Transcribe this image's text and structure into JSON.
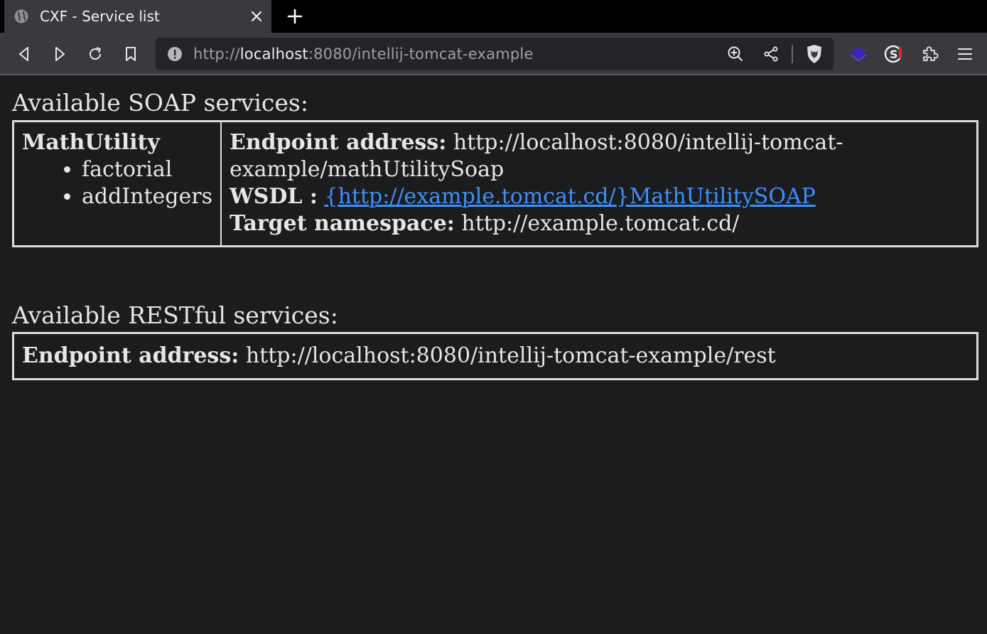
{
  "browser": {
    "tab": {
      "title": "CXF - Service list"
    },
    "address_bar": {
      "url_scheme": "http://",
      "url_host": "localhost",
      "url_rest": ":8080/intellij-tomcat-example"
    }
  },
  "page": {
    "soap": {
      "heading": "Available SOAP services:",
      "services": [
        {
          "name": "MathUtility",
          "operations": [
            "factorial",
            "addIntegers"
          ],
          "endpoint_label": "Endpoint address:",
          "endpoint_value": "http://localhost:8080/intellij-tomcat-example/mathUtilitySoap",
          "endpoint_line1": "http://localhost:8080/intellij-tomcat-",
          "endpoint_line2": "example/mathUtilitySoap",
          "wsdl_label": "WSDL :",
          "wsdl_link": "{http://example.tomcat.cd/}MathUtilitySOAP",
          "namespace_label": "Target namespace:",
          "namespace_value": "http://example.tomcat.cd/"
        }
      ]
    },
    "rest": {
      "heading": "Available RESTful services:",
      "endpoint_label": "Endpoint address:",
      "endpoint_value": "http://localhost:8080/intellij-tomcat-example/rest"
    }
  },
  "colors": {
    "page_background": "#1b1c1e",
    "link": "#3d8fff",
    "table_border": "#dcdcdc"
  }
}
